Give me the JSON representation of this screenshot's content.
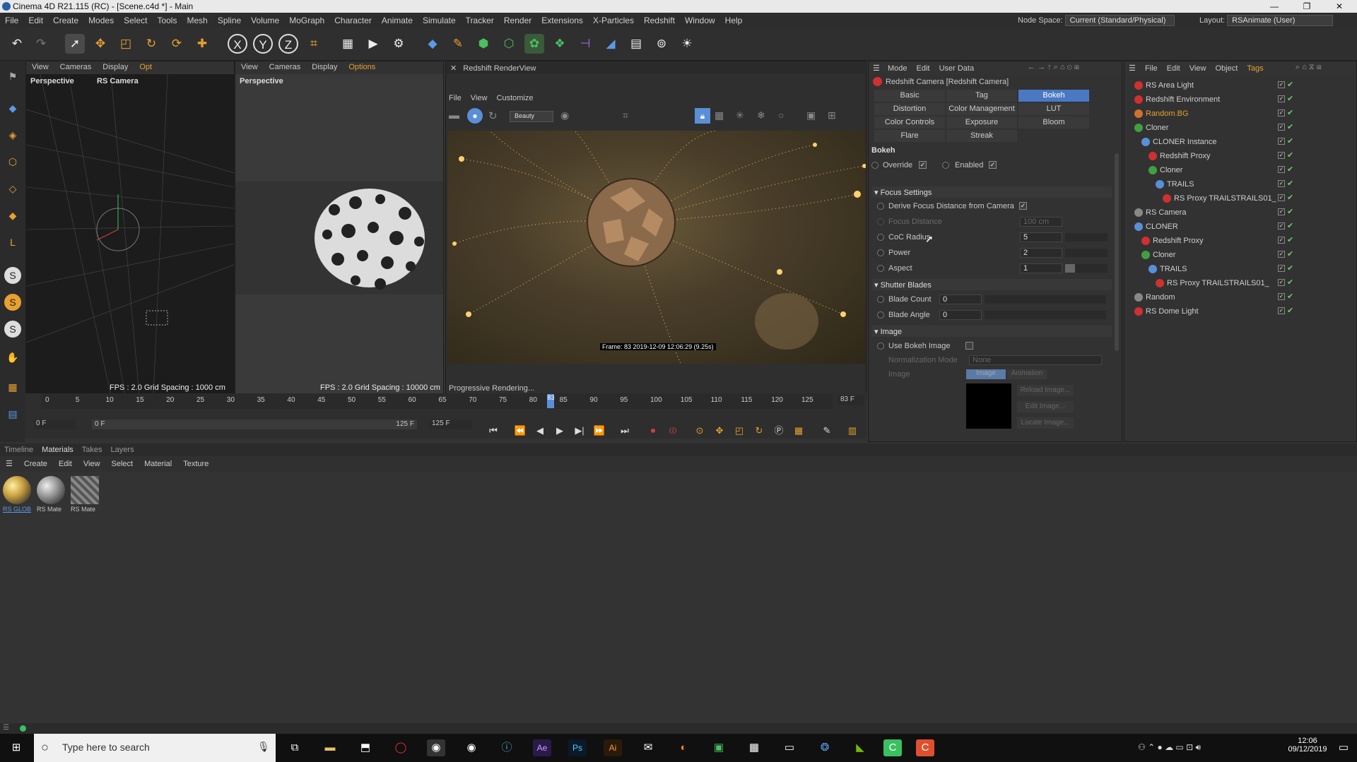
{
  "window": {
    "title": "Cinema 4D R21.115 (RC) - [Scene.c4d *] - Main",
    "min": "—",
    "max": "❐",
    "close": "✕"
  },
  "menu": {
    "items": [
      "File",
      "Edit",
      "Create",
      "Modes",
      "Select",
      "Tools",
      "Mesh",
      "Spline",
      "Volume",
      "MoGraph",
      "Character",
      "Animate",
      "Simulate",
      "Tracker",
      "Render",
      "Extensions",
      "X-Particles",
      "Redshift",
      "Window",
      "Help"
    ],
    "node_space_label": "Node Space:",
    "node_space_value": "Current (Standard/Physical)",
    "layout_label": "Layout:",
    "layout_value": "RSAnimate (User)"
  },
  "viewport1": {
    "menus": [
      "View",
      "Cameras",
      "Display",
      "Opt"
    ],
    "label": "Perspective",
    "camera": "RS Camera",
    "fps": "FPS : 2.0  Grid Spacing : 1000 cm"
  },
  "viewport2": {
    "menus": [
      "View",
      "Cameras",
      "Display",
      "Options"
    ],
    "label": "Perspective",
    "fps": "FPS : 2.0 Grid Spacing : 10000 cm"
  },
  "renderview": {
    "tab": "Redshift RenderView",
    "menus": [
      "File",
      "View",
      "Customize"
    ],
    "quality": "Beauty",
    "status": "Progressive Rendering...",
    "frame_stamp": "Frame: 83   2019-12-09  12:06:29  (9.25s)"
  },
  "attributes": {
    "menus": [
      "Mode",
      "Edit",
      "User Data"
    ],
    "object": "Redshift Camera [Redshift Camera]",
    "tabs_row1": [
      "Basic",
      "Tag",
      "Bokeh"
    ],
    "tabs_row2": [
      "Distortion",
      "Color Management",
      "LUT"
    ],
    "tabs_row3": [
      "Color Controls",
      "Exposure",
      "Bloom"
    ],
    "tabs_row4": [
      "Flare",
      "Streak"
    ],
    "section": "Bokeh",
    "override": "Override",
    "enabled": "Enabled",
    "focus_settings": "Focus Settings",
    "derive": "Derive Focus Distance from Camera",
    "focus_distance": {
      "label": "Focus Distance",
      "value": "100 cm"
    },
    "coc_radius": {
      "label": "CoC Radius",
      "value": "5"
    },
    "power": {
      "label": "Power",
      "value": "2"
    },
    "aspect": {
      "label": "Aspect",
      "value": "1"
    },
    "shutter_blades": "Shutter Blades",
    "blade_count": {
      "label": "Blade Count",
      "value": "0"
    },
    "blade_angle": {
      "label": "Blade Angle",
      "value": "0"
    },
    "image_section": "Image",
    "use_bokeh_image": "Use Bokeh Image",
    "normalization_mode": {
      "label": "Normalization Mode",
      "value": "None"
    },
    "image_label": "Image",
    "image_tab": "Image",
    "animation_tab": "Animation",
    "reload_image": "Reload Image...",
    "edit_image": "Edit Image...",
    "locate_image": "Locate Image..."
  },
  "objects": {
    "menus": [
      "File",
      "Edit",
      "View",
      "Object",
      "Tags"
    ],
    "list": [
      {
        "name": "RS Area Light",
        "indent": 0,
        "color": "#d03030"
      },
      {
        "name": "Redshift Environment",
        "indent": 0,
        "color": "#d03030"
      },
      {
        "name": "Random.BG",
        "indent": 0,
        "color": "#d07030",
        "highlight": true
      },
      {
        "name": "Cloner",
        "indent": 0,
        "color": "#40a040"
      },
      {
        "name": "CLONER Instance",
        "indent": 1,
        "color": "#5a8fd8"
      },
      {
        "name": "Redshift Proxy",
        "indent": 2,
        "color": "#d03030"
      },
      {
        "name": "Cloner",
        "indent": 2,
        "color": "#40a040"
      },
      {
        "name": "TRAILS",
        "indent": 3,
        "color": "#5a8fd8"
      },
      {
        "name": "RS Proxy TRAILSTRAILS01_",
        "indent": 4,
        "color": "#d03030"
      },
      {
        "name": "RS Camera",
        "indent": 0,
        "color": "#888888"
      },
      {
        "name": "CLONER",
        "indent": 0,
        "color": "#5a8fd8"
      },
      {
        "name": "Redshift Proxy",
        "indent": 1,
        "color": "#d03030"
      },
      {
        "name": "Cloner",
        "indent": 1,
        "color": "#40a040"
      },
      {
        "name": "TRAILS",
        "indent": 2,
        "color": "#5a8fd8"
      },
      {
        "name": "RS Proxy TRAILSTRAILS01_",
        "indent": 3,
        "color": "#d03030"
      },
      {
        "name": "Random",
        "indent": 0,
        "color": "#888888"
      },
      {
        "name": "RS Dome Light",
        "indent": 0,
        "color": "#d03030"
      }
    ]
  },
  "timeline": {
    "ticks": [
      "0",
      "5",
      "10",
      "15",
      "20",
      "25",
      "30",
      "35",
      "40",
      "45",
      "50",
      "55",
      "60",
      "65",
      "70",
      "75",
      "80",
      "85",
      "90",
      "95",
      "100",
      "105",
      "110",
      "115",
      "120",
      "125"
    ],
    "current": "83",
    "current_frame_field": "83 F",
    "start_field": "0 F",
    "range_start": "0 F",
    "range_end": "125 F",
    "end_field": "125 F"
  },
  "bottom_tabs": [
    "Timeline",
    "Materials",
    "Takes",
    "Layers"
  ],
  "material_menu": [
    "Create",
    "Edit",
    "View",
    "Select",
    "Material",
    "Texture"
  ],
  "materials": [
    {
      "name": "RS GLOB",
      "color": "#c8a040"
    },
    {
      "name": "RS Mate",
      "color": "#9a9a9a"
    },
    {
      "name": "RS Mate",
      "color": "#7a7a7a"
    }
  ],
  "taskbar": {
    "search_placeholder": "Type here to search",
    "time": "12:06",
    "date": "09/12/2019"
  }
}
